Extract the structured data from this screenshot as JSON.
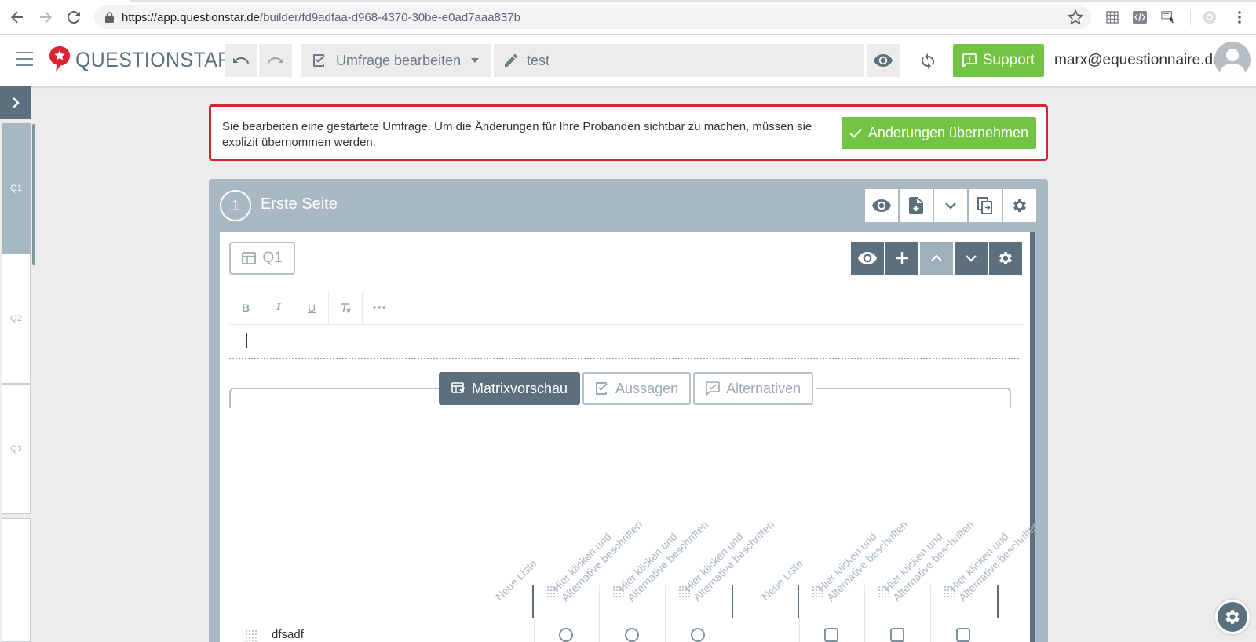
{
  "browser": {
    "url_host": "https://app.questionstar.de",
    "url_path": "/builder/fd9adfaa-d968-4370-30be-e0ad7aaa837b"
  },
  "header": {
    "logo_text": "QUESTIONSTAR",
    "mode_label": "Umfrage bearbeiten",
    "survey_title": "test",
    "support_label": "Support",
    "user_email": "marx@equestionnaire.de"
  },
  "sidebar": {
    "items": [
      {
        "label": "Q1",
        "active": true
      },
      {
        "label": "Q2",
        "active": false
      },
      {
        "label": "Q3",
        "active": false
      },
      {
        "label": "",
        "active": false
      }
    ]
  },
  "alert": {
    "message": "Sie bearbeiten eine gestartete Umfrage. Um die Änderungen für Ihre Probanden sichtbar zu machen, müssen sie explizit übernommen werden.",
    "apply_label": "Änderungen übernehmen"
  },
  "page": {
    "number": "1",
    "title": "Erste Seite"
  },
  "question": {
    "label": "Q1",
    "tabs": [
      {
        "label": "Matrixvorschau",
        "active": true
      },
      {
        "label": "Aussagen",
        "active": false
      },
      {
        "label": "Alternativen",
        "active": false
      }
    ]
  },
  "matrix": {
    "columns": [
      "Neue Liste",
      "Hier klicken und\nAlternative beschriften",
      "Hier klicken und\nAlternative beschriften",
      "Hier klicken und\nAlternative beschriften",
      "Neue Liste",
      "Hier klicken und\nAlternative beschriften",
      "Hier klicken und\nAlternative beschriften",
      "Hier klicken und\nAlternative beschriften"
    ],
    "row_label": "dfsadf"
  },
  "colors": {
    "brand_slate": "#5b6f7c",
    "green": "#72c442",
    "alert_red": "#d9232e",
    "page_bg": "#a9b9c3"
  }
}
